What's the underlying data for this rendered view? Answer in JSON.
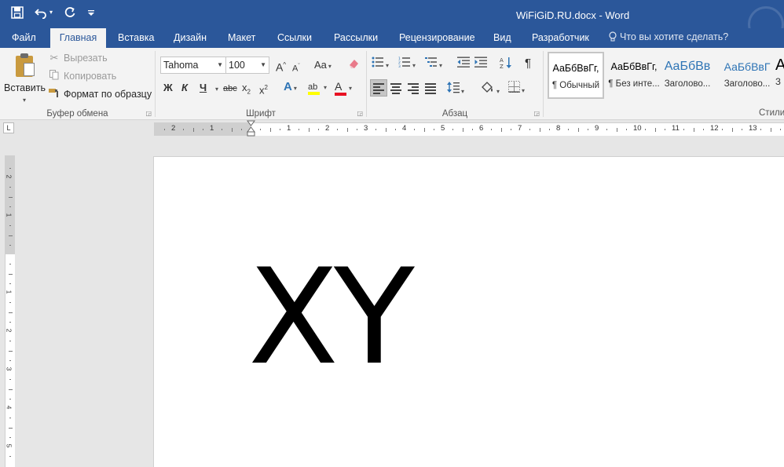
{
  "window": {
    "title": "WiFiGiD.RU.docx - Word"
  },
  "qat": {
    "save_icon": "save-icon",
    "undo_icon": "undo-icon",
    "redo_icon": "redo-icon",
    "customize_icon": "customize-qat-icon"
  },
  "tabs": [
    {
      "label": "Файл"
    },
    {
      "label": "Главная"
    },
    {
      "label": "Вставка"
    },
    {
      "label": "Дизайн"
    },
    {
      "label": "Макет"
    },
    {
      "label": "Ссылки"
    },
    {
      "label": "Рассылки"
    },
    {
      "label": "Рецензирование"
    },
    {
      "label": "Вид"
    },
    {
      "label": "Разработчик"
    }
  ],
  "tellme": {
    "placeholder": "Что вы хотите сделать?"
  },
  "clipboard": {
    "paste_label": "Вставить",
    "cut_label": "Вырезать",
    "copy_label": "Копировать",
    "format_painter_label": "Формат по образцу",
    "group_label": "Буфер обмена"
  },
  "font": {
    "name": "Tahoma",
    "size": "100",
    "grow_glyph": "A",
    "shrink_glyph": "A",
    "case_glyph": "Aa",
    "bold": "Ж",
    "italic": "К",
    "underline": "Ч",
    "strike": "abc",
    "subscript": "x",
    "superscript": "x",
    "sub_mark": "2",
    "sup_mark": "2",
    "effects_glyph": "A",
    "color_glyph": "A",
    "highlight_glyph": "ab",
    "highlight_color": "#ffff00",
    "font_color": "#e81123",
    "group_label": "Шрифт"
  },
  "paragraph": {
    "group_label": "Абзац",
    "pilcrow": "¶"
  },
  "styles": {
    "items": [
      {
        "sample": "АаБбВвГг,",
        "name": "¶ Обычный"
      },
      {
        "sample": "АаБбВвГг,",
        "name": "¶ Без инте..."
      },
      {
        "sample": "АаБбВв",
        "name": "Заголово..."
      },
      {
        "sample": "АаБбВвГ",
        "name": "Заголово..."
      },
      {
        "sample": "А",
        "name": "З"
      }
    ],
    "heading_color": "#2e74b5",
    "group_label": "Стили"
  },
  "ruler": {
    "tab_selector": "L",
    "labels_left": [
      "2",
      "1"
    ],
    "labels_right": [
      "1",
      "2",
      "3",
      "4",
      "5",
      "6",
      "7",
      "8",
      "9",
      "10",
      "11",
      "12",
      "13"
    ],
    "vertical_labels": [
      "2",
      "1",
      "1",
      "2",
      "3",
      "4",
      "5"
    ]
  },
  "document": {
    "text": "XY"
  }
}
